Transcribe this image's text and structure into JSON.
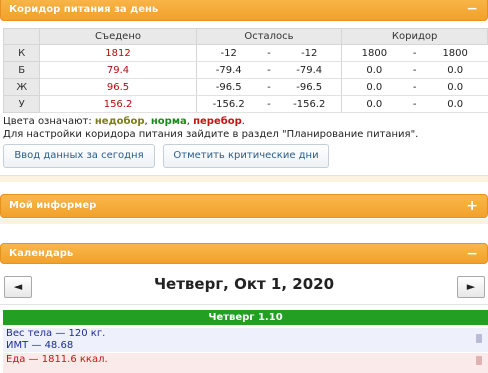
{
  "corridor": {
    "title": "Коридор питания за день",
    "toggle": "−",
    "headers": {
      "eaten": "Съедено",
      "left": "Осталось",
      "corridor": "Коридор"
    },
    "rows": [
      {
        "label": "К",
        "eaten": "1812",
        "left_min": "-12",
        "left_max": "-12",
        "corr_min": "1800",
        "corr_max": "1800"
      },
      {
        "label": "Б",
        "eaten": "79.4",
        "left_min": "-79.4",
        "left_max": "-79.4",
        "corr_min": "0.0",
        "corr_max": "0.0"
      },
      {
        "label": "Ж",
        "eaten": "96.5",
        "left_min": "-96.5",
        "left_max": "-96.5",
        "corr_min": "0.0",
        "corr_max": "0.0"
      },
      {
        "label": "У",
        "eaten": "156.2",
        "left_min": "-156.2",
        "left_max": "-156.2",
        "corr_min": "0.0",
        "corr_max": "0.0"
      }
    ],
    "dash": "-",
    "legend": {
      "prefix": "Цвета означают: ",
      "low": "недобор",
      "sep1": ", ",
      "ok": "норма",
      "sep2": ", ",
      "over": "перебор",
      "suffix": "."
    },
    "hint": "Для настройки коридора питания зайдите в раздел \"Планирование питания\".",
    "btn_today": "Ввод данных за сегодня",
    "btn_critical": "Отметить критические дни"
  },
  "informer": {
    "title": "Мой информер",
    "toggle": "+"
  },
  "calendar": {
    "title": "Календарь",
    "toggle": "−",
    "prev": "◄",
    "next": "►",
    "date": "Четверг, Окт 1, 2020",
    "day_label": "Четверг 1.10",
    "weight": "Вес тела — 120 кг.",
    "bmi": "ИМТ — 48.68",
    "food": "Еда — 1811.6 ккал."
  },
  "colors": {
    "header": "#f2a12c",
    "low": "#7d7d17",
    "ok": "#1a8a1a",
    "over": "#c41414",
    "day_bar": "#23a023",
    "link": "#2a5d8a"
  }
}
